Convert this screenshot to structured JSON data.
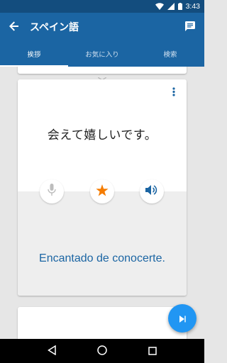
{
  "status_bar": {
    "time": "3:43",
    "icons": [
      "wifi-icon",
      "signal-icon",
      "battery-icon"
    ]
  },
  "app_bar": {
    "title": "スペイン語",
    "back_icon": "arrow-back-icon",
    "action_icon": "chat-icon"
  },
  "tabs": [
    {
      "label": "挨拶",
      "active": true
    },
    {
      "label": "お気に入り",
      "active": false
    },
    {
      "label": "検索",
      "active": false
    }
  ],
  "card": {
    "phrase_source": "会えて嬉しいです。",
    "phrase_target": "Encantado de conocerte.",
    "more_icon": "more-vert-icon",
    "actions": [
      {
        "name": "microphone",
        "icon": "mic-icon",
        "enabled": false
      },
      {
        "name": "favorite",
        "icon": "star-icon",
        "active": true
      },
      {
        "name": "speaker",
        "icon": "volume-icon",
        "enabled": true
      }
    ]
  },
  "fab": {
    "icon": "play-icon"
  },
  "colors": {
    "status_bar": "#134d7e",
    "primary": "#1b65a3",
    "accent_star": "#f57c00",
    "fab": "#2196f3",
    "background": "#e6e6e6"
  },
  "nav_bar": {
    "buttons": [
      "back-triangle-icon",
      "home-circle-icon",
      "recents-square-icon"
    ]
  }
}
